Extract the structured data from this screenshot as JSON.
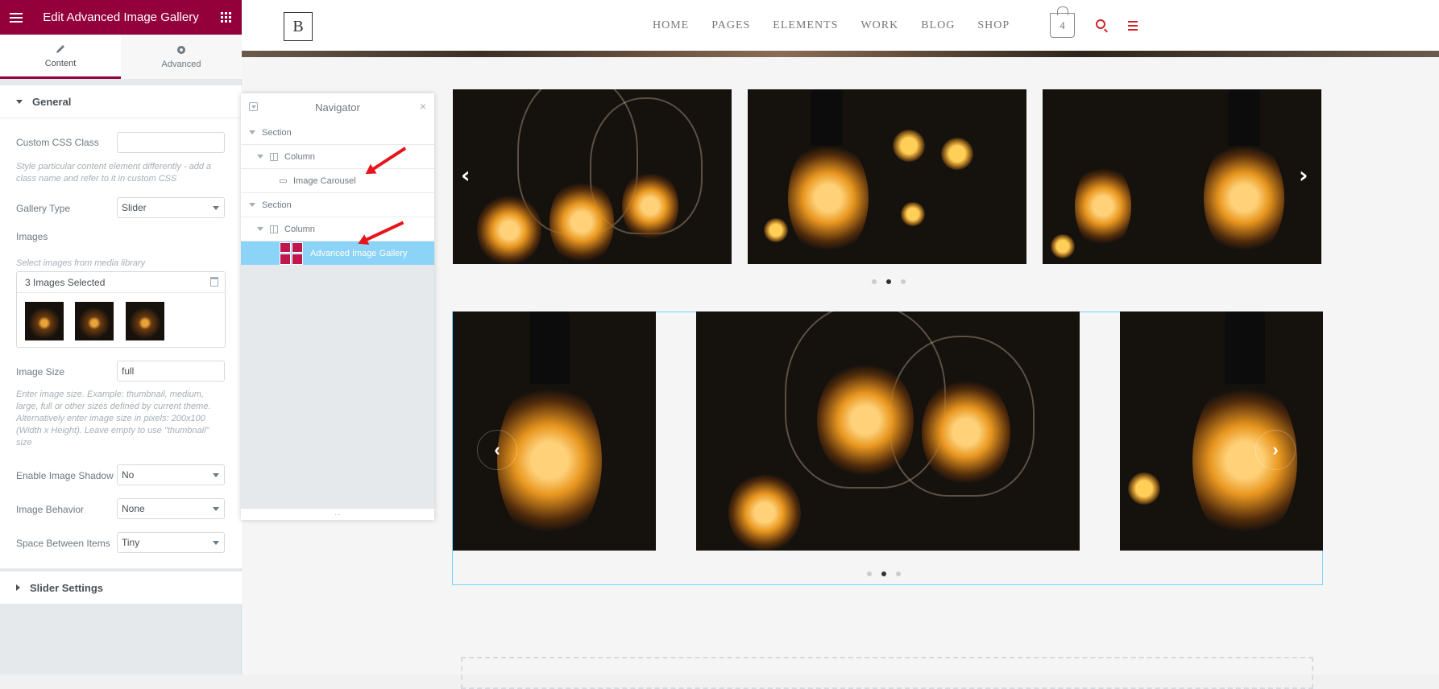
{
  "panel": {
    "title": "Edit Advanced Image Gallery",
    "tabs": [
      {
        "label": "Content"
      },
      {
        "label": "Advanced"
      }
    ],
    "general": {
      "heading": "General",
      "custom_css_label": "Custom CSS Class",
      "custom_css_value": "",
      "custom_css_desc": "Style particular content element differently - add a class name and refer to it in custom CSS",
      "gallery_type_label": "Gallery Type",
      "gallery_type_value": "Slider",
      "images_label": "Images",
      "images_desc": "Select images from media library",
      "images_selected": "3 Images Selected",
      "image_size_label": "Image Size",
      "image_size_value": "full",
      "image_size_desc": "Enter image size. Example: thumbnail, medium, large, full or other sizes defined by current theme. Alternatively enter image size in pixels: 200x100 (Width x Height). Leave empty to use \"thumbnail\" size",
      "shadow_label": "Enable Image Shadow",
      "shadow_value": "No",
      "behavior_label": "Image Behavior",
      "behavior_value": "None",
      "space_label": "Space Between Items",
      "space_value": "Tiny"
    },
    "slider_settings": "Slider Settings"
  },
  "navigator": {
    "title": "Navigator",
    "rows": [
      {
        "label": "Section"
      },
      {
        "label": "Column"
      },
      {
        "label": "Image Carousel"
      },
      {
        "label": "Section"
      },
      {
        "label": "Column"
      },
      {
        "label": "Advanced Image Gallery"
      }
    ],
    "footer": "..."
  },
  "site": {
    "logo": "B",
    "menu": [
      "HOME",
      "PAGES",
      "ELEMENTS",
      "WORK",
      "BLOG",
      "SHOP"
    ],
    "cart_count": "4"
  },
  "colors": {
    "brand": "#93003c",
    "selected": "#8bd3f7",
    "accent": "#d12229"
  }
}
